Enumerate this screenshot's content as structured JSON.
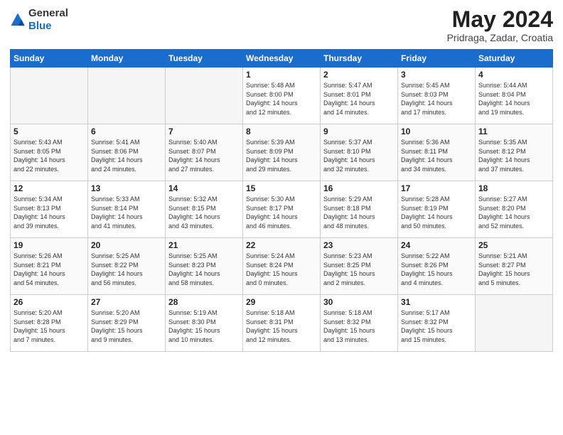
{
  "header": {
    "logo_general": "General",
    "logo_blue": "Blue",
    "month_title": "May 2024",
    "location": "Pridraga, Zadar, Croatia"
  },
  "days_of_week": [
    "Sunday",
    "Monday",
    "Tuesday",
    "Wednesday",
    "Thursday",
    "Friday",
    "Saturday"
  ],
  "weeks": [
    [
      {
        "day": "",
        "info": ""
      },
      {
        "day": "",
        "info": ""
      },
      {
        "day": "",
        "info": ""
      },
      {
        "day": "1",
        "info": "Sunrise: 5:48 AM\nSunset: 8:00 PM\nDaylight: 14 hours\nand 12 minutes."
      },
      {
        "day": "2",
        "info": "Sunrise: 5:47 AM\nSunset: 8:01 PM\nDaylight: 14 hours\nand 14 minutes."
      },
      {
        "day": "3",
        "info": "Sunrise: 5:45 AM\nSunset: 8:03 PM\nDaylight: 14 hours\nand 17 minutes."
      },
      {
        "day": "4",
        "info": "Sunrise: 5:44 AM\nSunset: 8:04 PM\nDaylight: 14 hours\nand 19 minutes."
      }
    ],
    [
      {
        "day": "5",
        "info": "Sunrise: 5:43 AM\nSunset: 8:05 PM\nDaylight: 14 hours\nand 22 minutes."
      },
      {
        "day": "6",
        "info": "Sunrise: 5:41 AM\nSunset: 8:06 PM\nDaylight: 14 hours\nand 24 minutes."
      },
      {
        "day": "7",
        "info": "Sunrise: 5:40 AM\nSunset: 8:07 PM\nDaylight: 14 hours\nand 27 minutes."
      },
      {
        "day": "8",
        "info": "Sunrise: 5:39 AM\nSunset: 8:09 PM\nDaylight: 14 hours\nand 29 minutes."
      },
      {
        "day": "9",
        "info": "Sunrise: 5:37 AM\nSunset: 8:10 PM\nDaylight: 14 hours\nand 32 minutes."
      },
      {
        "day": "10",
        "info": "Sunrise: 5:36 AM\nSunset: 8:11 PM\nDaylight: 14 hours\nand 34 minutes."
      },
      {
        "day": "11",
        "info": "Sunrise: 5:35 AM\nSunset: 8:12 PM\nDaylight: 14 hours\nand 37 minutes."
      }
    ],
    [
      {
        "day": "12",
        "info": "Sunrise: 5:34 AM\nSunset: 8:13 PM\nDaylight: 14 hours\nand 39 minutes."
      },
      {
        "day": "13",
        "info": "Sunrise: 5:33 AM\nSunset: 8:14 PM\nDaylight: 14 hours\nand 41 minutes."
      },
      {
        "day": "14",
        "info": "Sunrise: 5:32 AM\nSunset: 8:15 PM\nDaylight: 14 hours\nand 43 minutes."
      },
      {
        "day": "15",
        "info": "Sunrise: 5:30 AM\nSunset: 8:17 PM\nDaylight: 14 hours\nand 46 minutes."
      },
      {
        "day": "16",
        "info": "Sunrise: 5:29 AM\nSunset: 8:18 PM\nDaylight: 14 hours\nand 48 minutes."
      },
      {
        "day": "17",
        "info": "Sunrise: 5:28 AM\nSunset: 8:19 PM\nDaylight: 14 hours\nand 50 minutes."
      },
      {
        "day": "18",
        "info": "Sunrise: 5:27 AM\nSunset: 8:20 PM\nDaylight: 14 hours\nand 52 minutes."
      }
    ],
    [
      {
        "day": "19",
        "info": "Sunrise: 5:26 AM\nSunset: 8:21 PM\nDaylight: 14 hours\nand 54 minutes."
      },
      {
        "day": "20",
        "info": "Sunrise: 5:25 AM\nSunset: 8:22 PM\nDaylight: 14 hours\nand 56 minutes."
      },
      {
        "day": "21",
        "info": "Sunrise: 5:25 AM\nSunset: 8:23 PM\nDaylight: 14 hours\nand 58 minutes."
      },
      {
        "day": "22",
        "info": "Sunrise: 5:24 AM\nSunset: 8:24 PM\nDaylight: 15 hours\nand 0 minutes."
      },
      {
        "day": "23",
        "info": "Sunrise: 5:23 AM\nSunset: 8:25 PM\nDaylight: 15 hours\nand 2 minutes."
      },
      {
        "day": "24",
        "info": "Sunrise: 5:22 AM\nSunset: 8:26 PM\nDaylight: 15 hours\nand 4 minutes."
      },
      {
        "day": "25",
        "info": "Sunrise: 5:21 AM\nSunset: 8:27 PM\nDaylight: 15 hours\nand 5 minutes."
      }
    ],
    [
      {
        "day": "26",
        "info": "Sunrise: 5:20 AM\nSunset: 8:28 PM\nDaylight: 15 hours\nand 7 minutes."
      },
      {
        "day": "27",
        "info": "Sunrise: 5:20 AM\nSunset: 8:29 PM\nDaylight: 15 hours\nand 9 minutes."
      },
      {
        "day": "28",
        "info": "Sunrise: 5:19 AM\nSunset: 8:30 PM\nDaylight: 15 hours\nand 10 minutes."
      },
      {
        "day": "29",
        "info": "Sunrise: 5:18 AM\nSunset: 8:31 PM\nDaylight: 15 hours\nand 12 minutes."
      },
      {
        "day": "30",
        "info": "Sunrise: 5:18 AM\nSunset: 8:32 PM\nDaylight: 15 hours\nand 13 minutes."
      },
      {
        "day": "31",
        "info": "Sunrise: 5:17 AM\nSunset: 8:32 PM\nDaylight: 15 hours\nand 15 minutes."
      },
      {
        "day": "",
        "info": ""
      }
    ]
  ]
}
